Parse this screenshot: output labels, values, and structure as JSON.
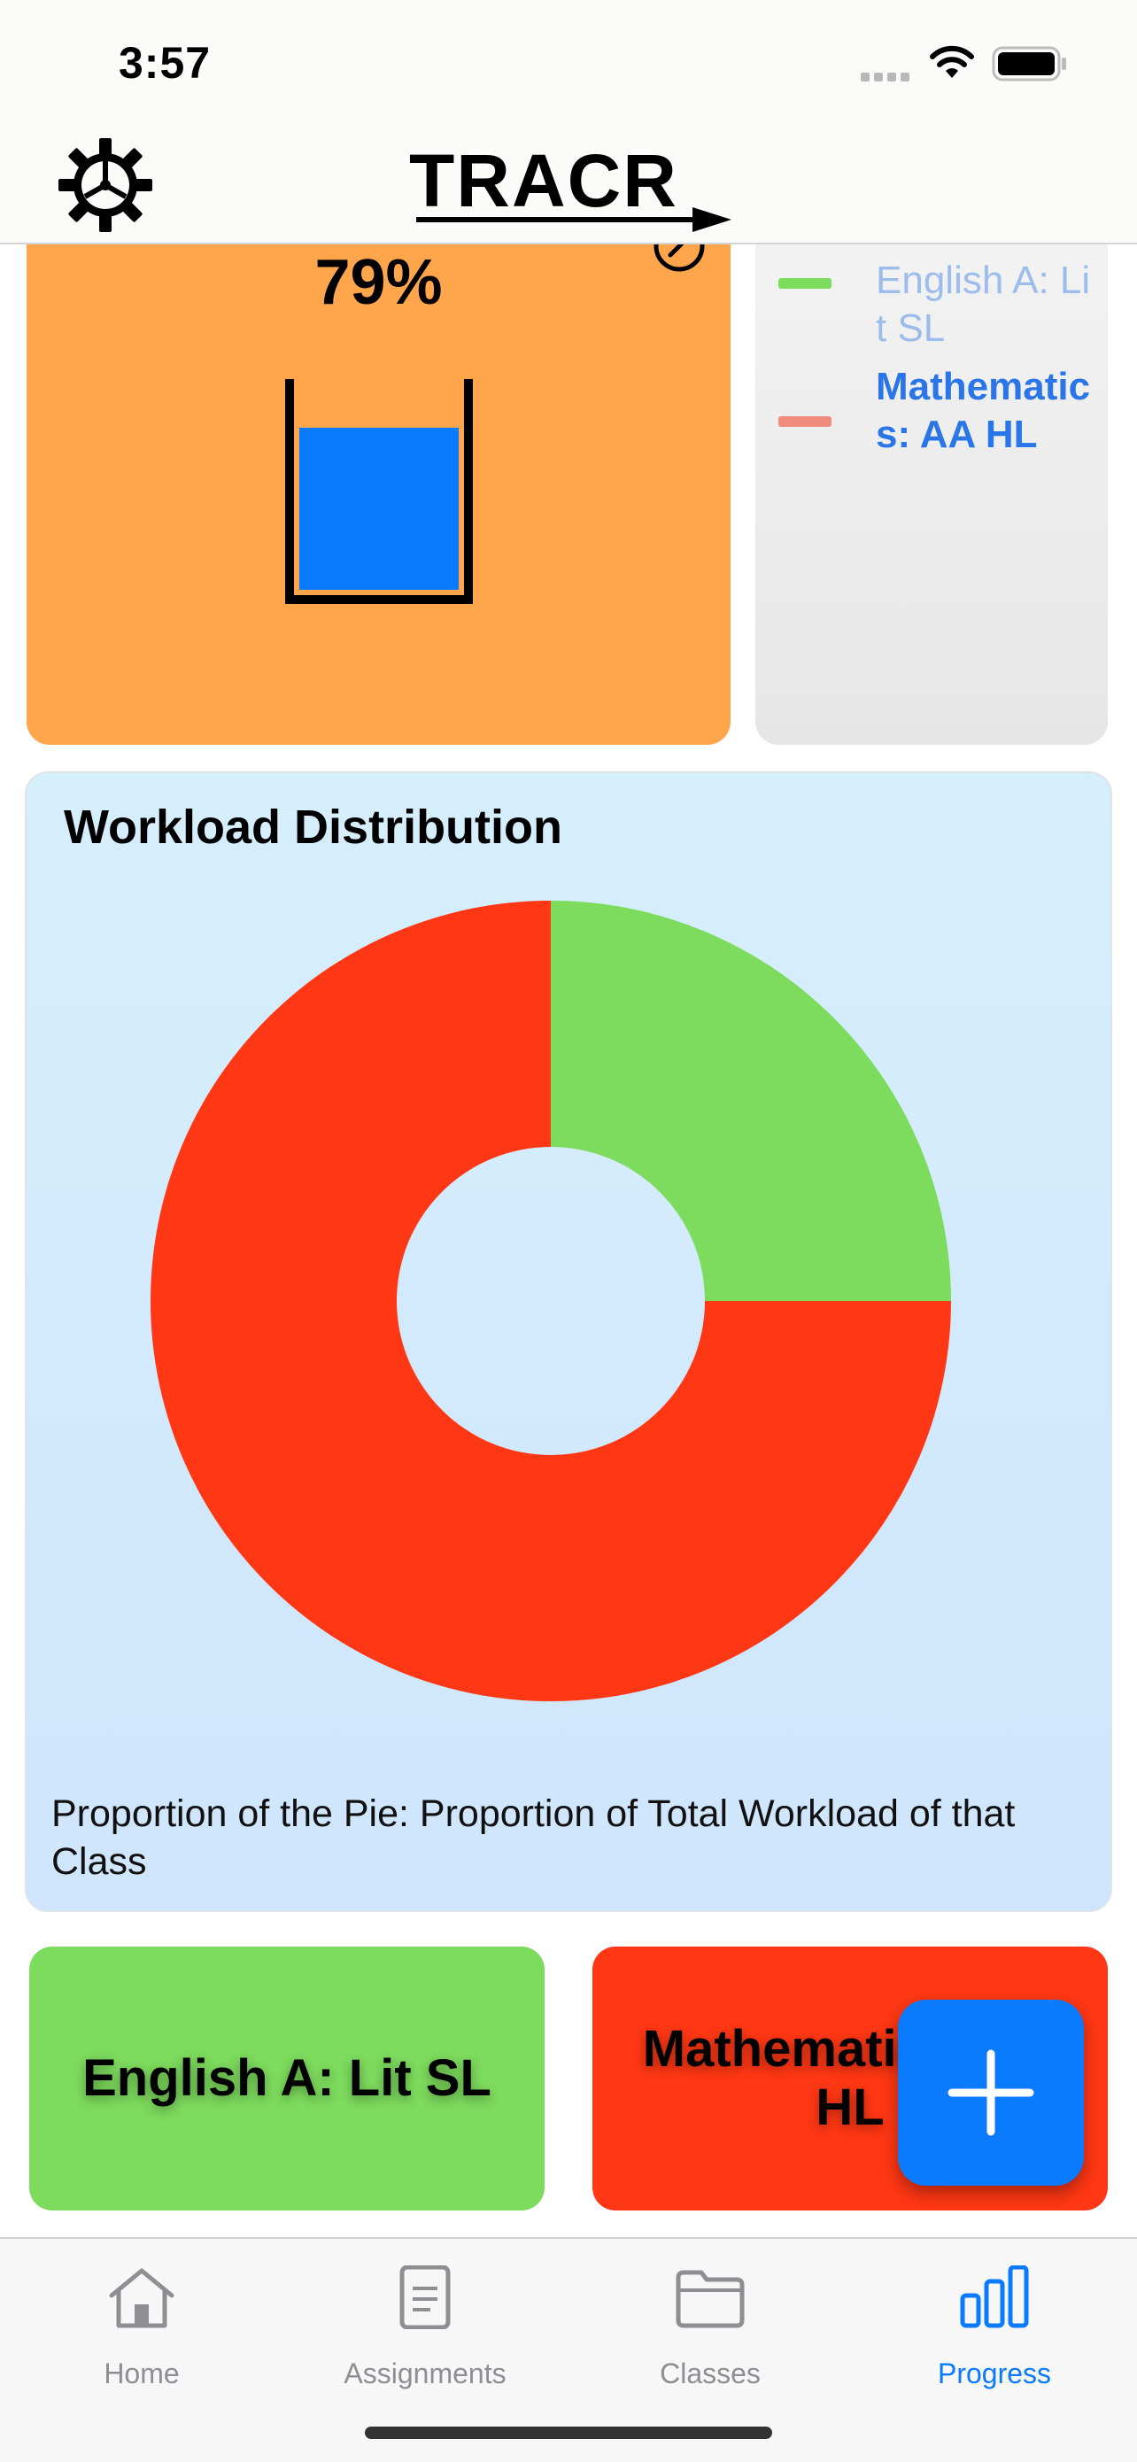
{
  "status_bar": {
    "time": "3:57"
  },
  "header": {
    "logo_text": "TRACR"
  },
  "progress_card": {
    "percent_label": "79%",
    "fill_fraction": 0.79,
    "color": "#ffa64d",
    "fill_color": "#0a7aff"
  },
  "legend": {
    "items": [
      {
        "label": "English A: Lit SL",
        "color": "#7ddb5d"
      },
      {
        "label": "Mathematics: AA HL",
        "color": "#f08c7d"
      }
    ]
  },
  "workload": {
    "title": "Workload Distribution",
    "caption": "Proportion of the Pie: Proportion of Total Workload of that Class",
    "chart_data": {
      "type": "pie",
      "donut": true,
      "categories": [
        "English A: Lit SL",
        "Mathematics: AA HL"
      ],
      "values": [
        25,
        75
      ],
      "colors": [
        "#7ddb5d",
        "#ff3714"
      ]
    }
  },
  "class_cards": [
    {
      "label": "English A: Lit SL",
      "color": "#7ddb5d"
    },
    {
      "label": "Mathematics: AA HL",
      "color": "#ff3714"
    }
  ],
  "tab_bar": {
    "tabs": [
      {
        "label": "Home",
        "icon": "house-icon",
        "active": false
      },
      {
        "label": "Assignments",
        "icon": "document-icon",
        "active": false
      },
      {
        "label": "Classes",
        "icon": "folder-icon",
        "active": false
      },
      {
        "label": "Progress",
        "icon": "bar-chart-icon",
        "active": true
      }
    ],
    "active_color": "#0a7aff",
    "inactive_color": "#8e8e93"
  }
}
